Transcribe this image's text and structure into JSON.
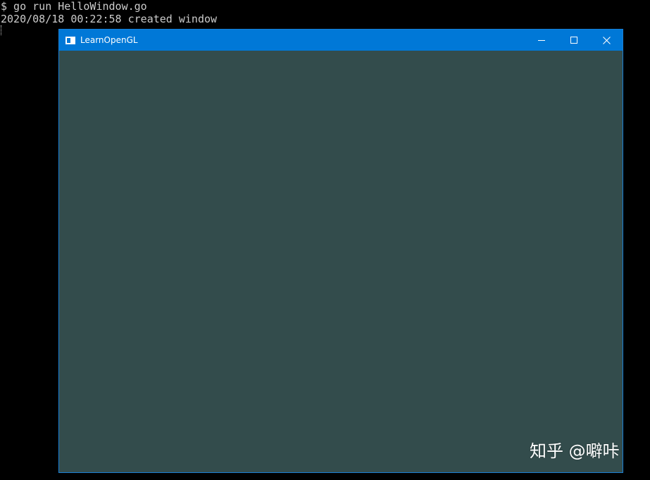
{
  "terminal": {
    "lines": [
      "$ go run HelloWindow.go",
      "2020/08/18 00:22:58 created window"
    ]
  },
  "window": {
    "title": "LearnOpenGL",
    "clear_color": "#334c4c",
    "accent_color": "#0078d7",
    "icons": {
      "app": "window-app-icon",
      "minimize": "minimize-icon",
      "maximize": "maximize-icon",
      "close": "close-icon"
    }
  },
  "watermark": {
    "text": "知乎 @噼咔"
  }
}
